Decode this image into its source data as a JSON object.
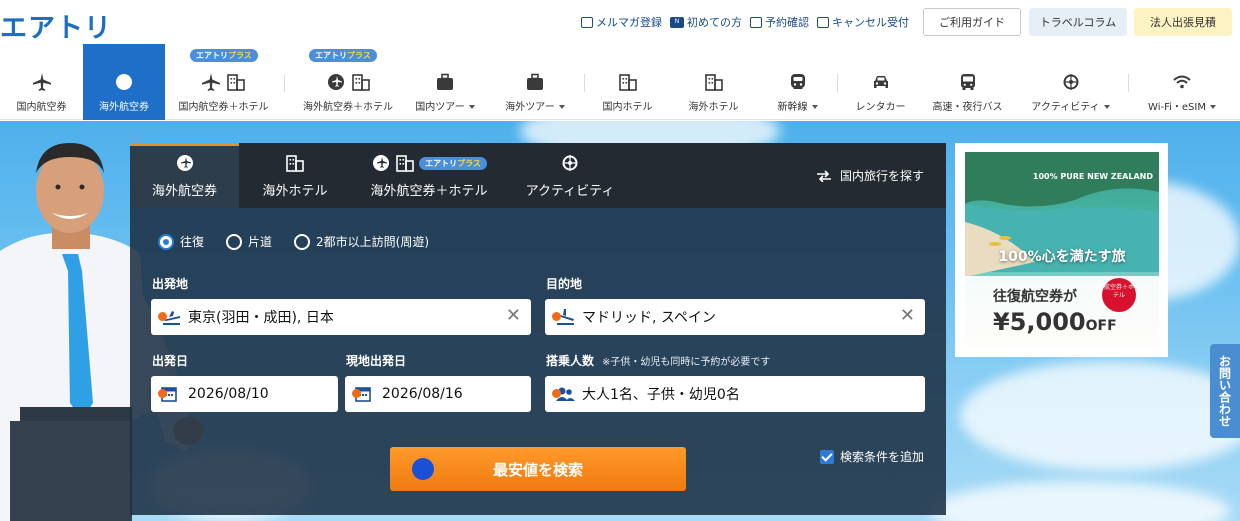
{
  "header": {
    "logo": "エアトリ",
    "links": [
      {
        "label": "メルマガ登録",
        "icon": "mail-icon"
      },
      {
        "label": "初めての方",
        "icon": "new-badge-icon"
      },
      {
        "label": "予約確認",
        "icon": "calendar-check-icon"
      },
      {
        "label": "キャンセル受付",
        "icon": "cancel-icon"
      }
    ],
    "guide_btn": "ご利用ガイド",
    "column_btn": "トラベルコラム",
    "biz_btn": "法人出張見積"
  },
  "nav": {
    "plus_badge_left": "エアトリ",
    "plus_badge_right": "プラス",
    "items": [
      {
        "label": "国内航空券",
        "icon": "plane-icon"
      },
      {
        "label": "海外航空券",
        "icon": "globe-plane-icon",
        "active": true
      },
      {
        "label": "国内航空券＋ホテル",
        "icon": "plane-hotel-icon"
      },
      {
        "label": "海外航空券＋ホテル",
        "icon": "globe-hotel-icon"
      },
      {
        "label": "国内ツアー",
        "icon": "suitcase-icon",
        "dropdown": true
      },
      {
        "label": "海外ツアー",
        "icon": "suitcase-icon",
        "dropdown": true
      },
      {
        "label": "国内ホテル",
        "icon": "hotel-icon"
      },
      {
        "label": "海外ホテル",
        "icon": "hotel-icon"
      },
      {
        "label": "新幹線",
        "icon": "train-icon",
        "dropdown": true
      },
      {
        "label": "レンタカー",
        "icon": "car-icon"
      },
      {
        "label": "高速・夜行バス",
        "icon": "bus-icon"
      },
      {
        "label": "アクティビティ",
        "icon": "activity-icon",
        "dropdown": true
      },
      {
        "label": "Wi-Fi・eSIM",
        "icon": "wifi-icon",
        "dropdown": true
      }
    ]
  },
  "search": {
    "tabs": [
      {
        "label": "海外航空券",
        "active": true
      },
      {
        "label": "海外ホテル"
      },
      {
        "label": "海外航空券＋ホテル"
      },
      {
        "label": "アクティビティ"
      }
    ],
    "domestic_link": "国内旅行を探す",
    "trip_types": [
      "往復",
      "片道",
      "2都市以上訪問(周遊)"
    ],
    "selected_trip_type": "往復",
    "origin_label": "出発地",
    "origin_value": "東京(羽田・成田), 日本",
    "dest_label": "目的地",
    "dest_value": "マドリッド, スペイン",
    "depart_label": "出発日",
    "depart_value": "2026/08/10",
    "return_label": "現地出発日",
    "return_value": "2026/08/16",
    "pax_label": "搭乗人数",
    "pax_note": "※子供・幼児も同時に予約が必要です",
    "pax_value": "大人1名、子供・幼児0名",
    "search_button": "最安値を検索",
    "add_conditions": "検索条件を追加"
  },
  "ad": {
    "brand": "100% PURE NEW ZEALAND",
    "catch": "100%心を満たす旅",
    "line1": "往復航空券が",
    "stamp": "航空券＋ホテル",
    "price": "¥5,000",
    "price_suffix": "OFF"
  },
  "sidetab": "お問い合わせ",
  "colors": {
    "brand": "#1d6fc8",
    "accent": "#f07a10",
    "panel": "#1c3044"
  }
}
